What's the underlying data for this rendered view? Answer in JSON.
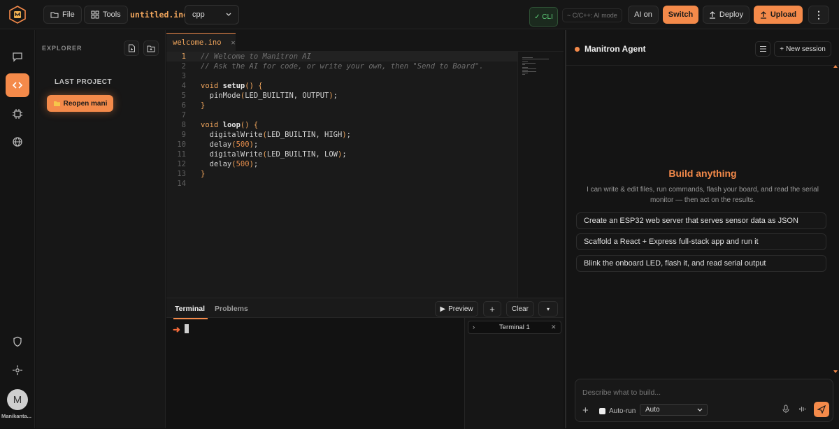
{
  "topbar": {
    "file_label": "File",
    "tools_label": "Tools",
    "filename": "untitled.ino",
    "language": "cpp",
    "cli_label": "✓ CLI",
    "mode_label": "~ C/C++: AI mode",
    "ai_label": "AI on",
    "switch_label": "Switch",
    "deploy_label": "Deploy",
    "upload_label": "Upload"
  },
  "sidebar": {
    "user_initial": "M",
    "user_name": "Manikanta..."
  },
  "explorer": {
    "title": "EXPLORER",
    "last_project_heading": "LAST PROJECT",
    "reopen_label": "Reopen mani"
  },
  "editor": {
    "tab_name": "welcome.ino",
    "lines": [
      {
        "n": "1",
        "t": "// Welcome to Manitron AI"
      },
      {
        "n": "2",
        "t": "// Ask the AI for code, or write your own, then \"Send to Board\"."
      },
      {
        "n": "3",
        "t": ""
      },
      {
        "n": "4",
        "t": "void setup() {"
      },
      {
        "n": "5",
        "t": "  pinMode(LED_BUILTIN, OUTPUT);"
      },
      {
        "n": "6",
        "t": "}"
      },
      {
        "n": "7",
        "t": ""
      },
      {
        "n": "8",
        "t": "void loop() {"
      },
      {
        "n": "9",
        "t": "  digitalWrite(LED_BUILTIN, HIGH);"
      },
      {
        "n": "10",
        "t": "  delay(500);"
      },
      {
        "n": "11",
        "t": "  digitalWrite(LED_BUILTIN, LOW);"
      },
      {
        "n": "12",
        "t": "  delay(500);"
      },
      {
        "n": "13",
        "t": "}"
      },
      {
        "n": "14",
        "t": ""
      }
    ]
  },
  "terminal": {
    "tab_terminal": "Terminal",
    "tab_problems": "Problems",
    "preview_label": "Preview",
    "clear_label": "Clear",
    "prompt": "➜",
    "session_name": "Terminal 1"
  },
  "agent": {
    "title": "Manitron Agent",
    "new_session_label": "New session",
    "heading": "Build anything",
    "subtitle": "I can write & edit files, run commands, flash your board, and read the serial monitor — then act on the results.",
    "suggestions": [
      "Create an ESP32 web server that serves sensor data as JSON",
      "Scaffold a React + Express full-stack app and run it",
      "Blink the onboard LED, flash it, and read serial output"
    ],
    "input_placeholder": "Describe what to build...",
    "autorun_label": "Auto-run",
    "model_select": "Auto"
  },
  "colors": {
    "accent": "#f48a4a",
    "background": "#121212",
    "cli_green": "#5fd07a"
  }
}
